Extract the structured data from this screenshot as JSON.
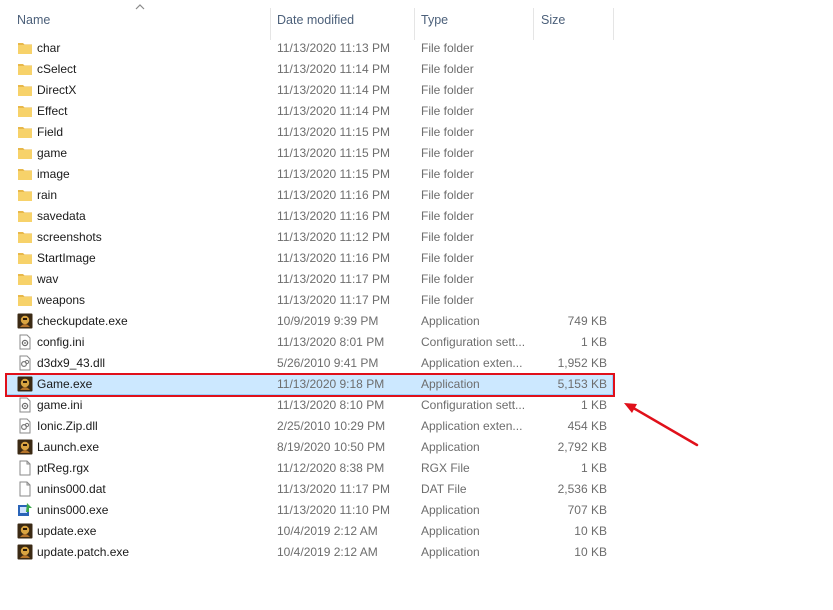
{
  "columns": {
    "name": "Name",
    "date": "Date modified",
    "type": "Type",
    "size": "Size"
  },
  "files": [
    {
      "name": "char",
      "date": "11/13/2020 11:13 PM",
      "type": "File folder",
      "size": "",
      "icon": "folder-icon"
    },
    {
      "name": "cSelect",
      "date": "11/13/2020 11:14 PM",
      "type": "File folder",
      "size": "",
      "icon": "folder-icon"
    },
    {
      "name": "DirectX",
      "date": "11/13/2020 11:14 PM",
      "type": "File folder",
      "size": "",
      "icon": "folder-icon"
    },
    {
      "name": "Effect",
      "date": "11/13/2020 11:14 PM",
      "type": "File folder",
      "size": "",
      "icon": "folder-icon"
    },
    {
      "name": "Field",
      "date": "11/13/2020 11:15 PM",
      "type": "File folder",
      "size": "",
      "icon": "folder-icon"
    },
    {
      "name": "game",
      "date": "11/13/2020 11:15 PM",
      "type": "File folder",
      "size": "",
      "icon": "folder-icon"
    },
    {
      "name": "image",
      "date": "11/13/2020 11:15 PM",
      "type": "File folder",
      "size": "",
      "icon": "folder-icon"
    },
    {
      "name": "rain",
      "date": "11/13/2020 11:16 PM",
      "type": "File folder",
      "size": "",
      "icon": "folder-icon"
    },
    {
      "name": "savedata",
      "date": "11/13/2020 11:16 PM",
      "type": "File folder",
      "size": "",
      "icon": "folder-icon"
    },
    {
      "name": "screenshots",
      "date": "11/13/2020 11:12 PM",
      "type": "File folder",
      "size": "",
      "icon": "folder-icon"
    },
    {
      "name": "StartImage",
      "date": "11/13/2020 11:16 PM",
      "type": "File folder",
      "size": "",
      "icon": "folder-icon"
    },
    {
      "name": "wav",
      "date": "11/13/2020 11:17 PM",
      "type": "File folder",
      "size": "",
      "icon": "folder-icon"
    },
    {
      "name": "weapons",
      "date": "11/13/2020 11:17 PM",
      "type": "File folder",
      "size": "",
      "icon": "folder-icon"
    },
    {
      "name": "checkupdate.exe",
      "date": "10/9/2019 9:39 PM",
      "type": "Application",
      "size": "749 KB",
      "icon": "app-game-icon"
    },
    {
      "name": "config.ini",
      "date": "11/13/2020 8:01 PM",
      "type": "Configuration sett...",
      "size": "1 KB",
      "icon": "config-file-icon"
    },
    {
      "name": "d3dx9_43.dll",
      "date": "5/26/2010 9:41 PM",
      "type": "Application exten...",
      "size": "1,952 KB",
      "icon": "dll-file-icon"
    },
    {
      "name": "Game.exe",
      "date": "11/13/2020 9:18 PM",
      "type": "Application",
      "size": "5,153 KB",
      "icon": "app-game-icon",
      "selected": true
    },
    {
      "name": "game.ini",
      "date": "11/13/2020 8:10 PM",
      "type": "Configuration sett...",
      "size": "1 KB",
      "icon": "config-file-icon"
    },
    {
      "name": "Ionic.Zip.dll",
      "date": "2/25/2010 10:29 PM",
      "type": "Application exten...",
      "size": "454 KB",
      "icon": "dll-file-icon"
    },
    {
      "name": "Launch.exe",
      "date": "8/19/2020 10:50 PM",
      "type": "Application",
      "size": "2,792 KB",
      "icon": "app-game-icon"
    },
    {
      "name": "ptReg.rgx",
      "date": "11/12/2020 8:38 PM",
      "type": "RGX File",
      "size": "1 KB",
      "icon": "blank-file-icon"
    },
    {
      "name": "unins000.dat",
      "date": "11/13/2020 11:17 PM",
      "type": "DAT File",
      "size": "2,536 KB",
      "icon": "blank-file-icon"
    },
    {
      "name": "unins000.exe",
      "date": "11/13/2020 11:10 PM",
      "type": "Application",
      "size": "707 KB",
      "icon": "installer-icon"
    },
    {
      "name": "update.exe",
      "date": "10/4/2019 2:12 AM",
      "type": "Application",
      "size": "10 KB",
      "icon": "app-game-icon"
    },
    {
      "name": "update.patch.exe",
      "date": "10/4/2019 2:12 AM",
      "type": "Application",
      "size": "10 KB",
      "icon": "app-game-icon"
    }
  ],
  "colors": {
    "selection": "#cce8ff",
    "highlight": "#e0101a",
    "folder": "#f7d26a"
  }
}
